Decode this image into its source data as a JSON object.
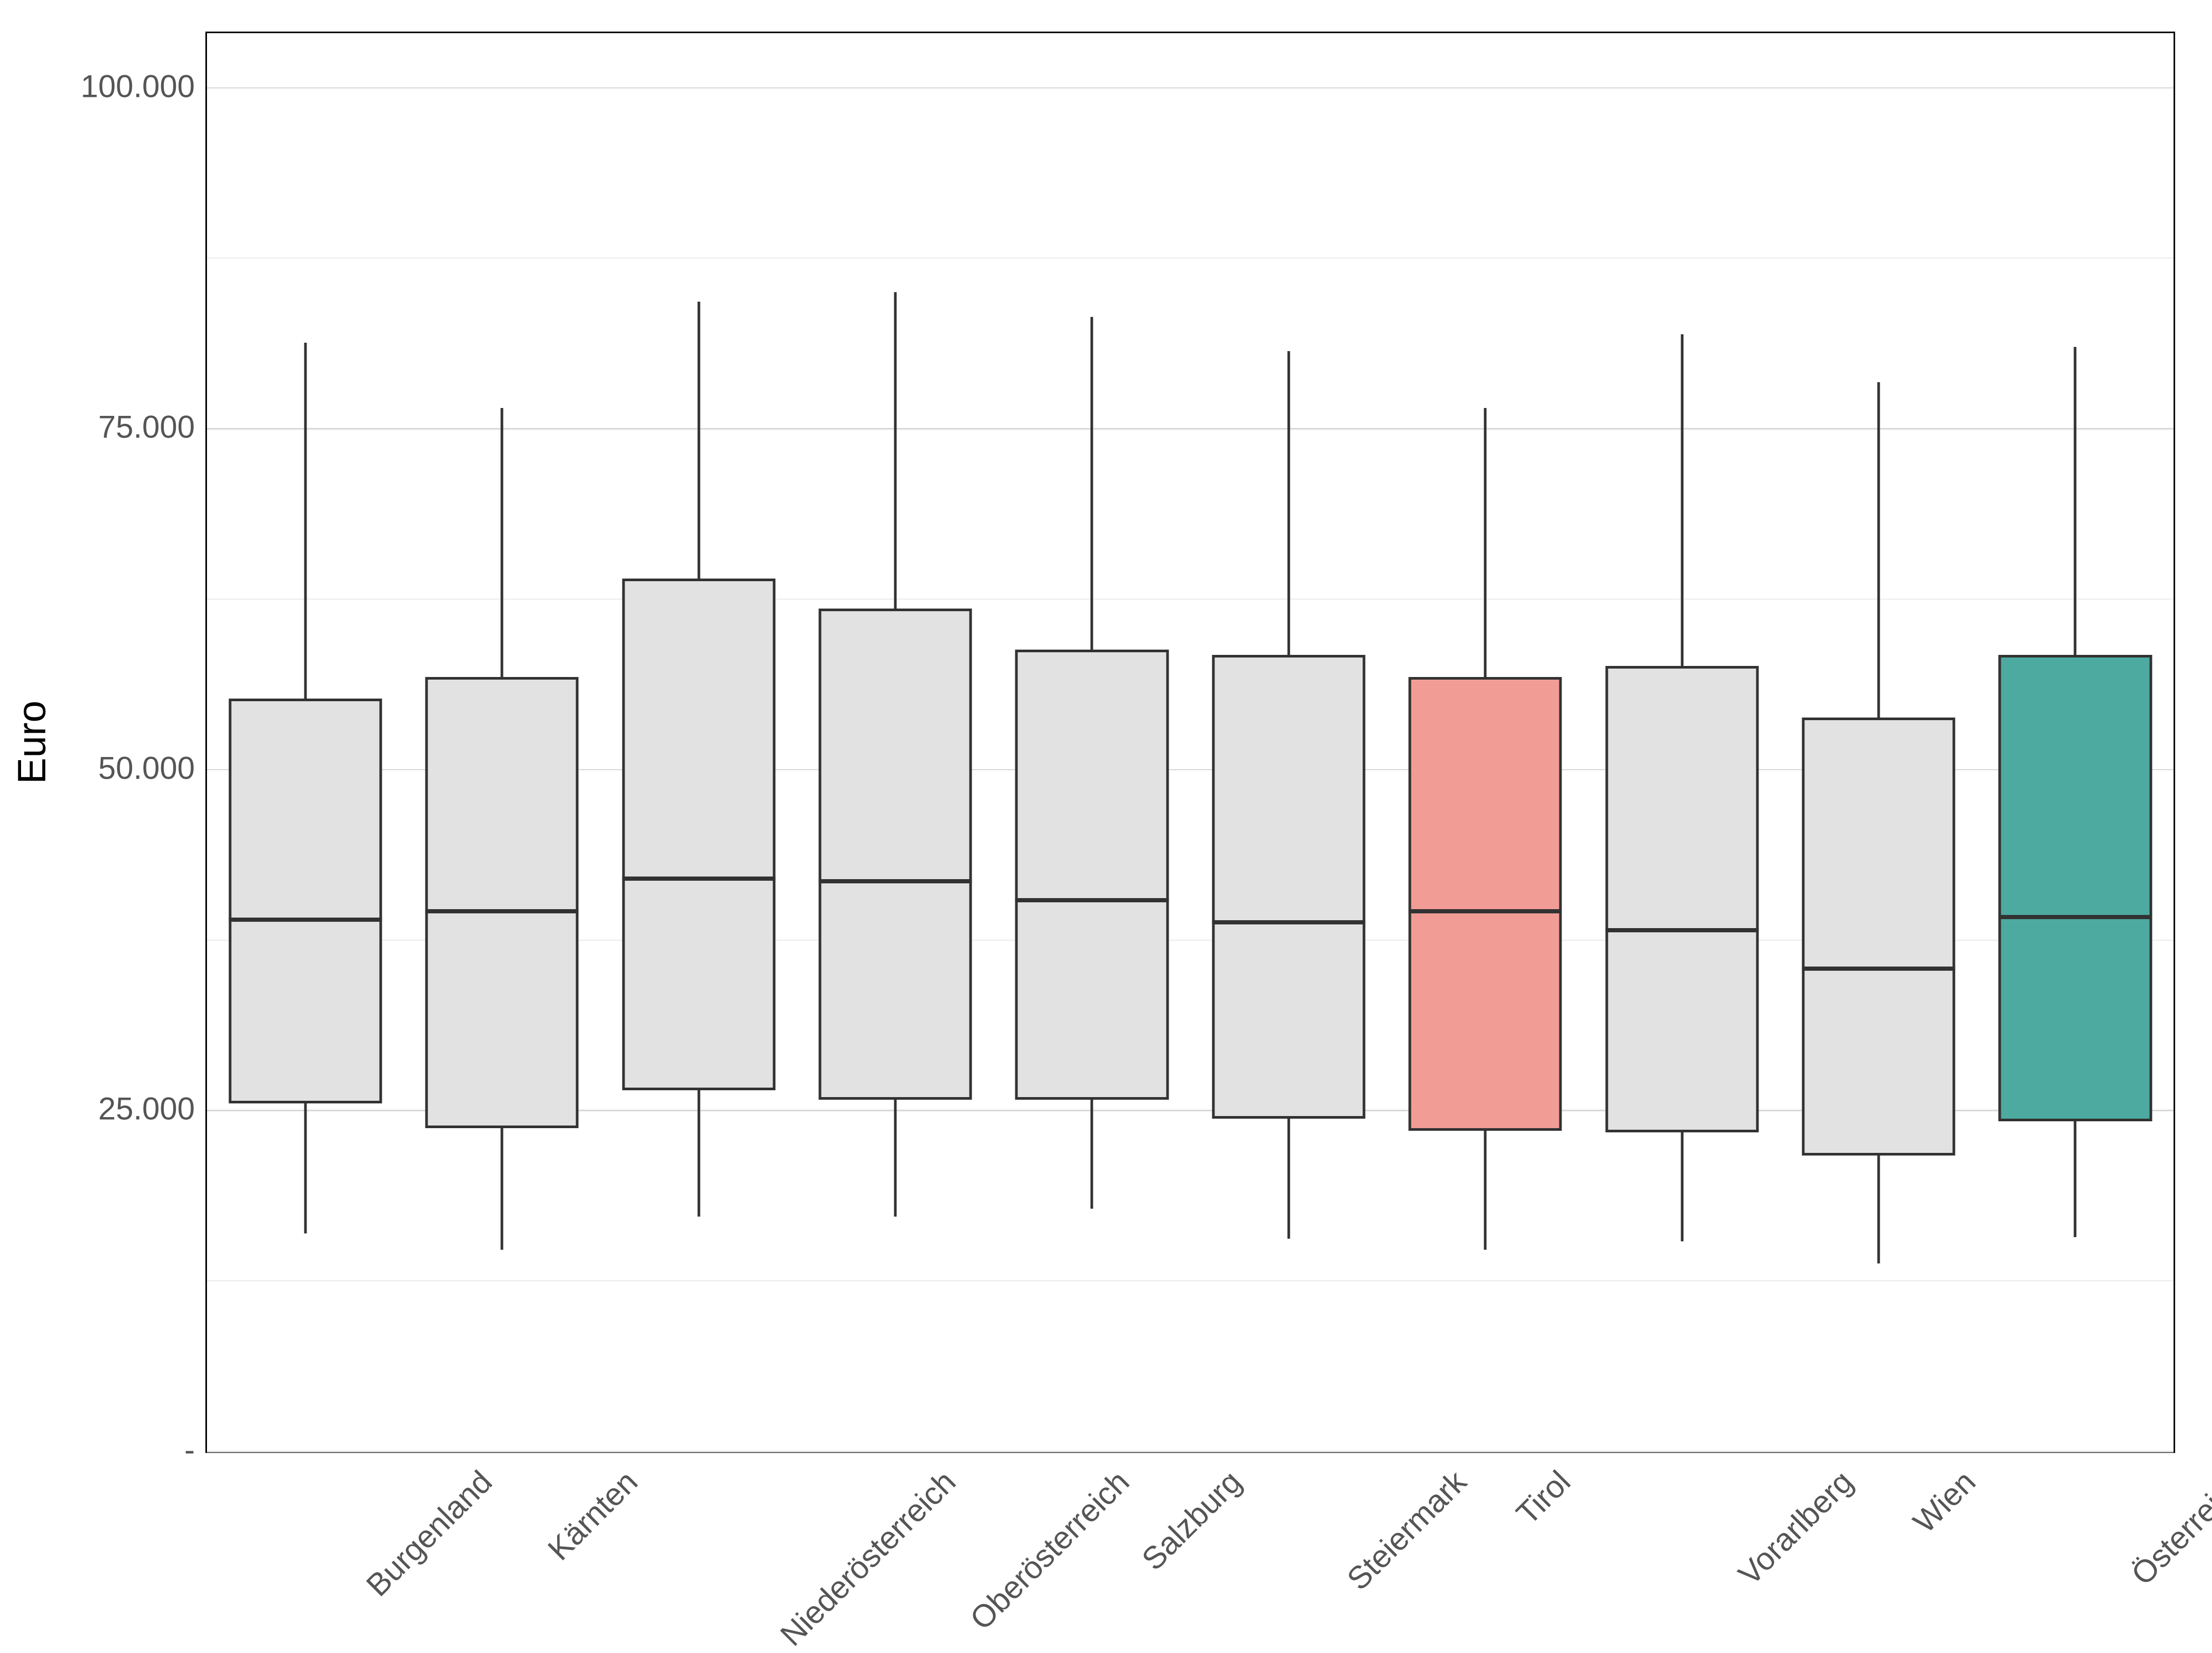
{
  "chart_data": {
    "type": "box",
    "ylabel": "Euro",
    "ylim": [
      0,
      104000
    ],
    "y_ticks": [
      0,
      25000,
      50000,
      75000,
      100000
    ],
    "y_tick_labels": [
      "-",
      "25.000",
      "50.000",
      "75.000",
      "100.000"
    ],
    "categories": [
      "Burgenland",
      "Kärnten",
      "Niederösterreich",
      "Oberösterreich",
      "Salzburg",
      "Steiermark",
      "Tirol",
      "Vorarlberg",
      "Wien",
      "Österreich"
    ],
    "series": [
      {
        "name": "Burgenland",
        "low": 16000,
        "q1": 25500,
        "median": 39000,
        "q3": 55200,
        "high": 81300,
        "color": "#e2e2e2"
      },
      {
        "name": "Kärnten",
        "low": 14800,
        "q1": 23700,
        "median": 39600,
        "q3": 56800,
        "high": 76500,
        "color": "#e2e2e2"
      },
      {
        "name": "Niederösterreich",
        "low": 17200,
        "q1": 26500,
        "median": 42000,
        "q3": 64000,
        "high": 84300,
        "color": "#e2e2e2"
      },
      {
        "name": "Oberösterreich",
        "low": 17200,
        "q1": 25800,
        "median": 41800,
        "q3": 61800,
        "high": 85000,
        "color": "#e2e2e2"
      },
      {
        "name": "Salzburg",
        "low": 17800,
        "q1": 25800,
        "median": 40400,
        "q3": 58800,
        "high": 83200,
        "color": "#e2e2e2"
      },
      {
        "name": "Steiermark",
        "low": 15600,
        "q1": 24400,
        "median": 38800,
        "q3": 58400,
        "high": 80700,
        "color": "#e2e2e2"
      },
      {
        "name": "Tirol",
        "low": 14800,
        "q1": 23500,
        "median": 39600,
        "q3": 56800,
        "high": 76500,
        "color": "#f19d96"
      },
      {
        "name": "Vorarlberg",
        "low": 15400,
        "q1": 23400,
        "median": 38200,
        "q3": 57600,
        "high": 81900,
        "color": "#e2e2e2"
      },
      {
        "name": "Wien",
        "low": 13800,
        "q1": 21700,
        "median": 35400,
        "q3": 53800,
        "high": 78400,
        "color": "#e2e2e2"
      },
      {
        "name": "Österreich",
        "low": 15700,
        "q1": 24200,
        "median": 39200,
        "q3": 58400,
        "high": 81000,
        "color": "#4caaa0"
      }
    ],
    "colors": {
      "default": "#e2e2e2",
      "highlight": "#f19d96",
      "total": "#4caaa0"
    }
  }
}
